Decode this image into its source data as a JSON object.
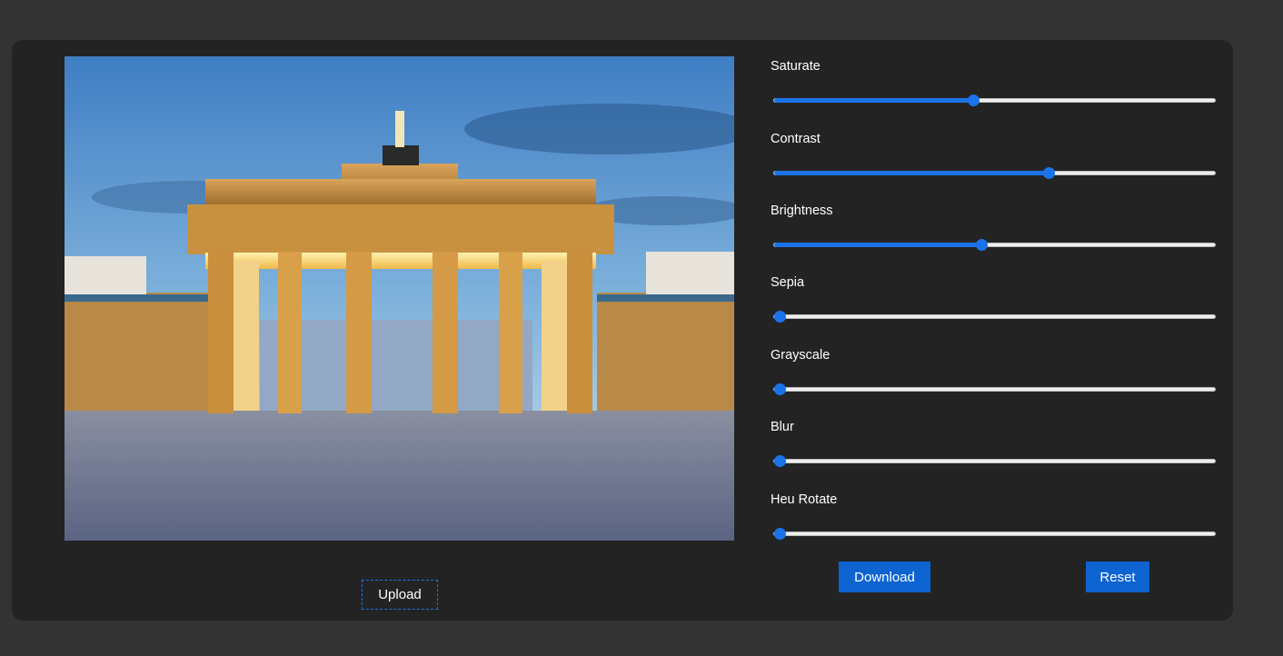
{
  "sliders": [
    {
      "label": "Saturate",
      "level": 0.45
    },
    {
      "label": "Contrast",
      "level": 0.625
    },
    {
      "label": "Brightness",
      "level": 0.47
    },
    {
      "label": "Sepia",
      "level": 0
    },
    {
      "label": "Grayscale",
      "level": 0
    },
    {
      "label": "Blur",
      "level": 0
    },
    {
      "label": "Heu Rotate",
      "level": 0
    }
  ],
  "buttons": {
    "upload_label": "Upload",
    "download_label": "Download",
    "reset_label": "Reset"
  },
  "colors": {
    "accent": "#1a73e8",
    "button": "#0d63d0",
    "panel": "#232323",
    "background": "#333333"
  }
}
